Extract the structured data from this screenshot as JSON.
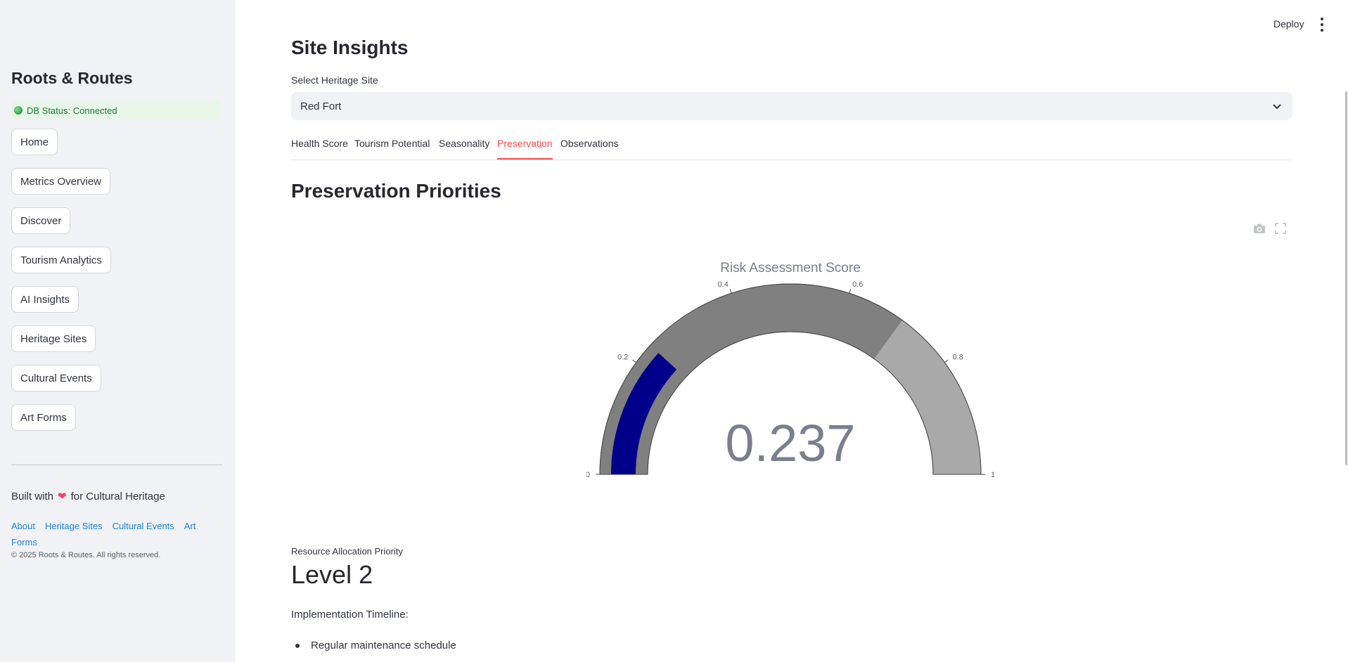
{
  "sidebar": {
    "brand": "Roots & Routes",
    "db_status": "DB Status: Connected",
    "nav": [
      "Home",
      "Metrics Overview",
      "Discover",
      "Tourism Analytics",
      "AI Insights",
      "Heritage Sites",
      "Cultural Events",
      "Art Forms"
    ],
    "built_prefix": "Built with",
    "built_suffix": "for Cultural Heritage",
    "heart_icon": "heart-icon",
    "links": [
      "About",
      "Heritage Sites",
      "Cultural Events",
      "Art Forms"
    ],
    "copyright": "© 2025 Roots & Routes. All rights reserved."
  },
  "header": {
    "deploy_label": "Deploy"
  },
  "main": {
    "title": "Site Insights",
    "select_label": "Select Heritage Site",
    "select_value": "Red Fort",
    "tabs": [
      "Health Score",
      "Tourism Potential",
      "Seasonality",
      "Preservation",
      "Observations"
    ],
    "active_tab": "Preservation",
    "section_title": "Preservation Priorities",
    "metric_label": "Resource Allocation Priority",
    "metric_value": "Level 2",
    "timeline_label": "Implementation Timeline:",
    "timeline_items": [
      "Regular maintenance schedule"
    ]
  },
  "chart_data": {
    "type": "gauge",
    "title": "Risk Assessment Score",
    "value": 0.237,
    "value_text": "0.237",
    "range": [
      0,
      1
    ],
    "ticks": [
      "0",
      "0.2",
      "0.4",
      "0.6",
      "0.8",
      "1"
    ],
    "tick_values": [
      0,
      0.2,
      0.4,
      0.6,
      0.8,
      1
    ],
    "steps": [
      {
        "range": [
          0,
          0.3
        ],
        "color": "#d3d3d3"
      },
      {
        "range": [
          0,
          0.7
        ],
        "color": "#808080"
      },
      {
        "range": [
          0.7,
          1
        ],
        "color": "#a9a9a9"
      }
    ],
    "bar_color": "#00008b"
  }
}
